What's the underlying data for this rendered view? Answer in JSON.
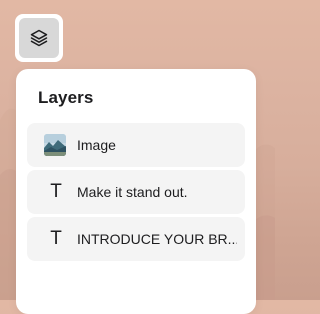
{
  "toolbar": {
    "layers_button_icon": "layers-icon"
  },
  "panel": {
    "title": "Layers",
    "layers": [
      {
        "type": "image",
        "icon": "image-thumbnail-icon",
        "label": "Image"
      },
      {
        "type": "text",
        "icon": "text-T-icon",
        "glyph": "T",
        "label": "Make it stand out."
      },
      {
        "type": "text",
        "icon": "text-T-icon",
        "glyph": "T",
        "label": "INTRODUCE YOUR BR..."
      }
    ]
  },
  "colors": {
    "background": "#dcb3a1",
    "panel": "#ffffff",
    "row": "#f4f4f4",
    "toggle_inner": "#d8d8d8",
    "text": "#1d1d1f"
  }
}
